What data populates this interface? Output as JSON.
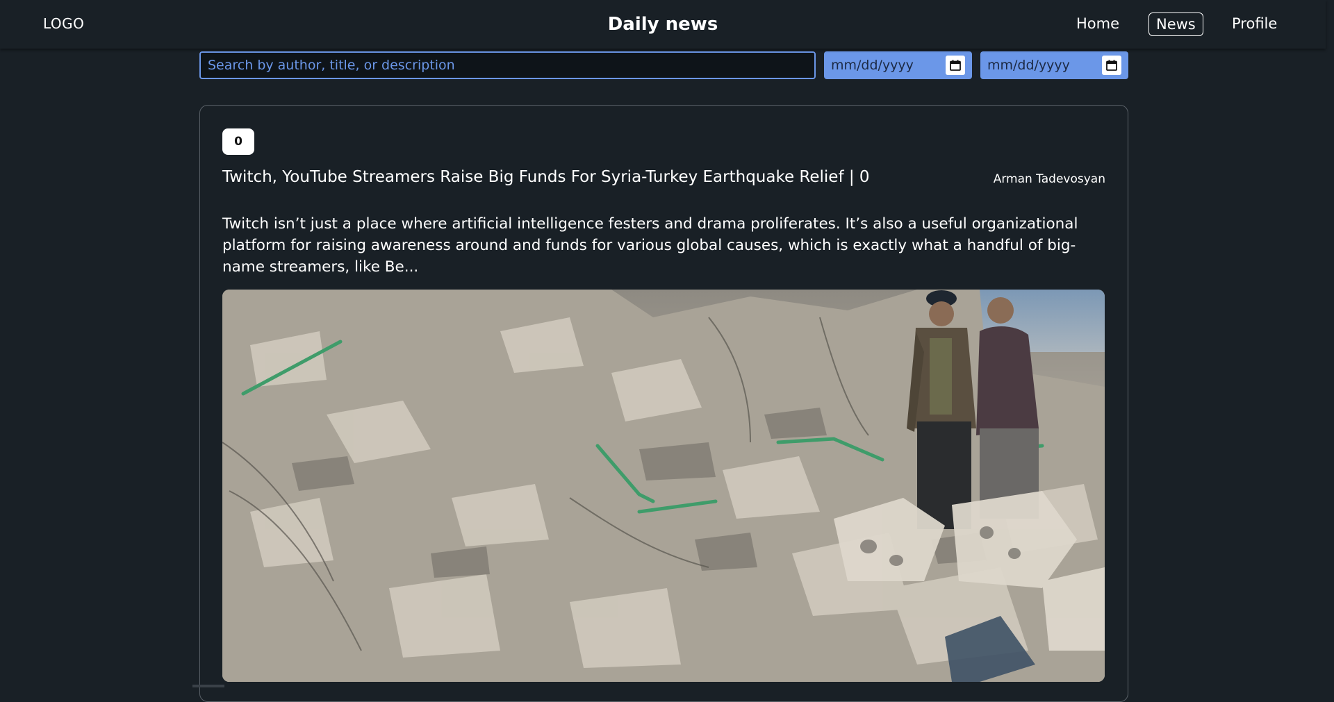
{
  "header": {
    "logo": "LOGO",
    "title": "Daily news",
    "nav": {
      "home": "Home",
      "news": "News",
      "profile": "Profile"
    }
  },
  "filters": {
    "search_placeholder": "Search by author, title, or description",
    "date_from_placeholder": "mm/dd/yyyy",
    "date_to_placeholder": "mm/dd/yyyy"
  },
  "article": {
    "badge": "0",
    "title": "Twitch, YouTube Streamers Raise Big Funds For Syria-Turkey Earthquake Relief | 0",
    "author": "Arman Tadevosyan",
    "description": "Twitch isn’t just a place where artificial intelligence festers and drama proliferates. It’s also a useful organizational platform for raising awareness around and funds for various global causes, which is exactly what a handful of big-name streamers, like Be..."
  },
  "colors": {
    "background": "#192026",
    "accent": "#6b97e8",
    "card_border": "#5a6168"
  },
  "icons": {
    "calendar": "calendar-icon"
  }
}
